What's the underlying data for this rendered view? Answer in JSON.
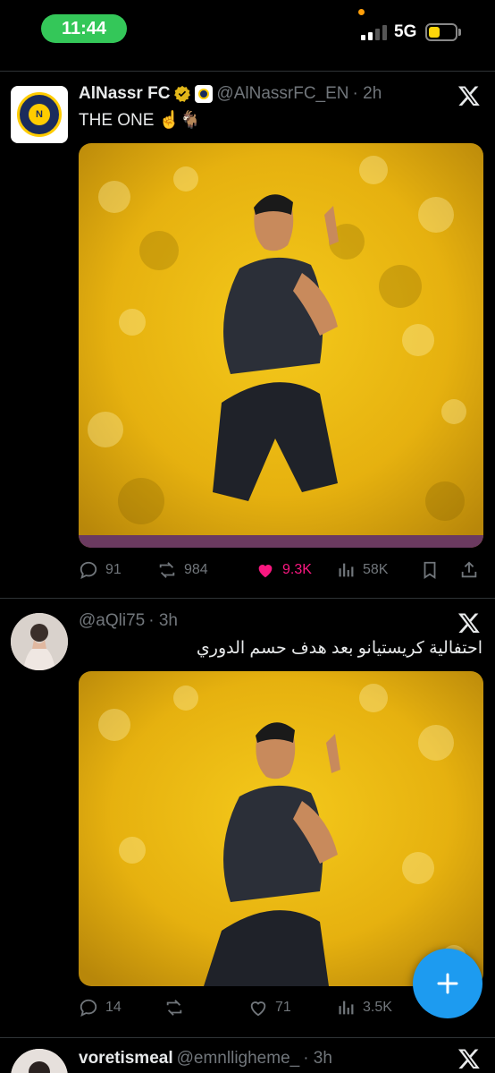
{
  "status_bar": {
    "time": "11:44",
    "network": "5G",
    "battery_color": "#ffd60a",
    "pill_color": "#34c759"
  },
  "tweets": [
    {
      "name": "AlNassr FC",
      "handle": "@AlNassrFC_EN",
      "time": "· 2h",
      "text": "THE ONE ☝️🐐",
      "image_icon": "player-celebration-photo",
      "stats": {
        "replies": "91",
        "retweets": "984",
        "likes": "9.3K",
        "views": "58K"
      }
    },
    {
      "name": "",
      "handle": "@aQli75",
      "time": "· 3h",
      "text": "احتفالية كريستيانو بعد هدف حسم الدوري",
      "image_icon": "player-celebration-photo",
      "stats": {
        "replies": "14",
        "retweets": "",
        "likes": "71",
        "views": "3.5K"
      }
    },
    {
      "name": "voretismeal",
      "handle": "@emnlligheme_",
      "time": "· 3h"
    }
  ],
  "colors": {
    "like_active": "#f91880",
    "accent": "#1d9bf0",
    "muted": "#71767b"
  }
}
